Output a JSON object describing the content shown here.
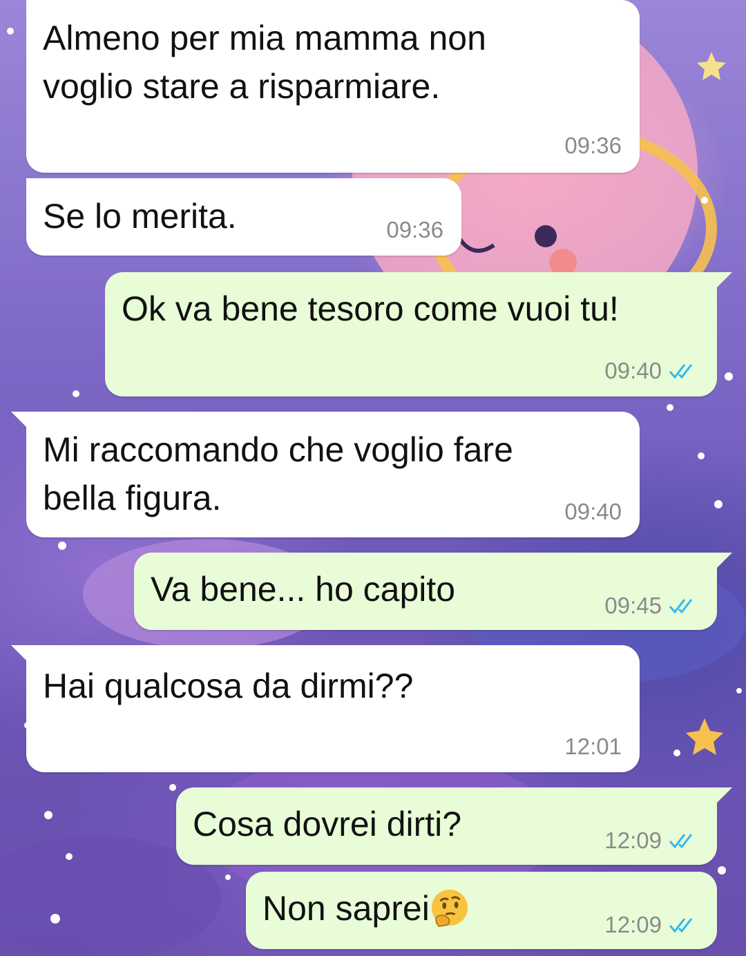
{
  "messages": [
    {
      "direction": "incoming",
      "text": "Almeno per mia mamma non\nvoglio stare a risparmiare.",
      "time": "09:36"
    },
    {
      "direction": "incoming",
      "text": "Se lo merita.",
      "time": "09:36"
    },
    {
      "direction": "outgoing",
      "text": "Ok va bene tesoro come vuoi tu!",
      "time": "09:40",
      "status": "read"
    },
    {
      "direction": "incoming",
      "text": "Mi raccomando che voglio fare\nbella figura.",
      "time": "09:40"
    },
    {
      "direction": "outgoing",
      "text": "Va bene... ho capito",
      "time": "09:45",
      "status": "read"
    },
    {
      "direction": "incoming",
      "text": "Hai qualcosa da dirmi??",
      "time": "12:01"
    },
    {
      "direction": "outgoing",
      "text": "Cosa dovrei dirti?",
      "time": "12:09",
      "status": "read"
    },
    {
      "direction": "outgoing",
      "text": "Non saprei",
      "emoji": "thinking-face",
      "time": "12:09",
      "status": "read"
    }
  ],
  "colors": {
    "incoming_bubble": "#ffffff",
    "outgoing_bubble": "#e7fcd7",
    "time_text": "#8a8a8a",
    "read_ticks": "#34b7f1"
  }
}
